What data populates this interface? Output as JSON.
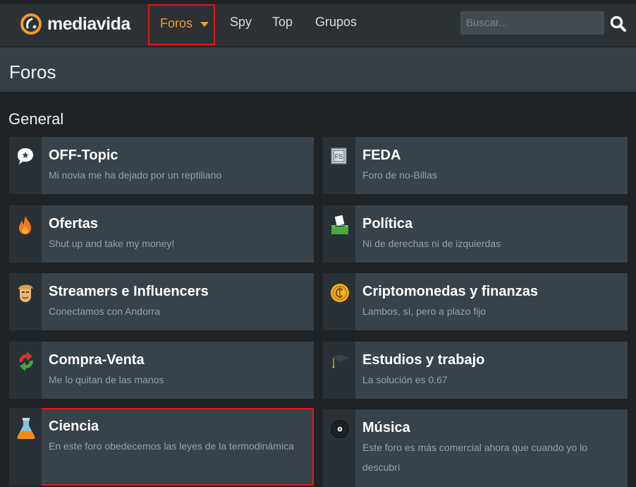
{
  "nav": {
    "logo_text": "mediavida",
    "items": [
      {
        "label": "Foros",
        "active": true
      },
      {
        "label": "Spy"
      },
      {
        "label": "Top"
      },
      {
        "label": "Grupos"
      }
    ],
    "search_placeholder": "Buscar...",
    "accent_color": "#f29a2e"
  },
  "page": {
    "title": "Foros",
    "section": "General"
  },
  "forums": [
    {
      "name": "OFF-Topic",
      "desc": "Mi novia me ha dejado por un reptiliano",
      "icon": "speech-bubble-icon"
    },
    {
      "name": "FEDA",
      "desc": "Foro de no-Billas",
      "icon": "fs-badge-icon"
    },
    {
      "name": "Ofertas",
      "desc": "Shut up and take my money!",
      "icon": "flame-icon"
    },
    {
      "name": "Política",
      "desc": "Ni de derechas ni de izquierdas",
      "icon": "ballot-box-icon"
    },
    {
      "name": "Streamers e Influencers",
      "desc": "Conectamos con Andorra",
      "icon": "face-icon"
    },
    {
      "name": "Criptomonedas y finanzas",
      "desc": "Lambos, sí, pero a plazo fijo",
      "icon": "coin-icon"
    },
    {
      "name": "Compra-Venta",
      "desc": "Me lo quitan de las manos",
      "icon": "exchange-arrows-icon"
    },
    {
      "name": "Estudios y trabajo",
      "desc": "La solución es 0,67",
      "icon": "graduation-cap-icon"
    },
    {
      "name": "Ciencia",
      "desc": "En este foro obedecemos las leyes de la termodinámica",
      "icon": "flask-icon",
      "selected": true
    },
    {
      "name": "Música",
      "desc": "Este foro es más comercial ahora que cuando yo lo descubrí",
      "icon": "vinyl-record-icon"
    }
  ]
}
